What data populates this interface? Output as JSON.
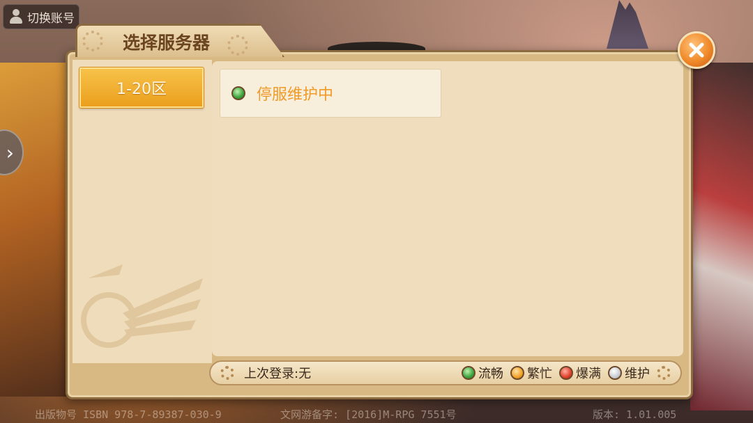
{
  "switch_account": {
    "label": "切换账号",
    "icon": "person-icon"
  },
  "dialog": {
    "title": "选择服务器",
    "close_icon": "close-icon"
  },
  "zones": [
    {
      "label": "1-20区",
      "selected": true
    }
  ],
  "servers": [
    {
      "name": "停服维护中",
      "status": "流畅",
      "status_color": "#3aa33d"
    }
  ],
  "footer": {
    "last_login": "上次登录:无",
    "legend": [
      {
        "label": "流畅",
        "color": "#3aa33d"
      },
      {
        "label": "繁忙",
        "color": "#f1a229"
      },
      {
        "label": "爆满",
        "color": "#e0402d"
      },
      {
        "label": "维护",
        "color": "#c8cdd3"
      }
    ]
  },
  "bottom_info": {
    "publish_no": "出版物号  ISBN 978-7-89387-030-9",
    "culture_no": "文网游备字:  [2016]M-RPG 7551号",
    "version": "版本: 1.01.005"
  },
  "side_arrow": "chevron-right-icon"
}
